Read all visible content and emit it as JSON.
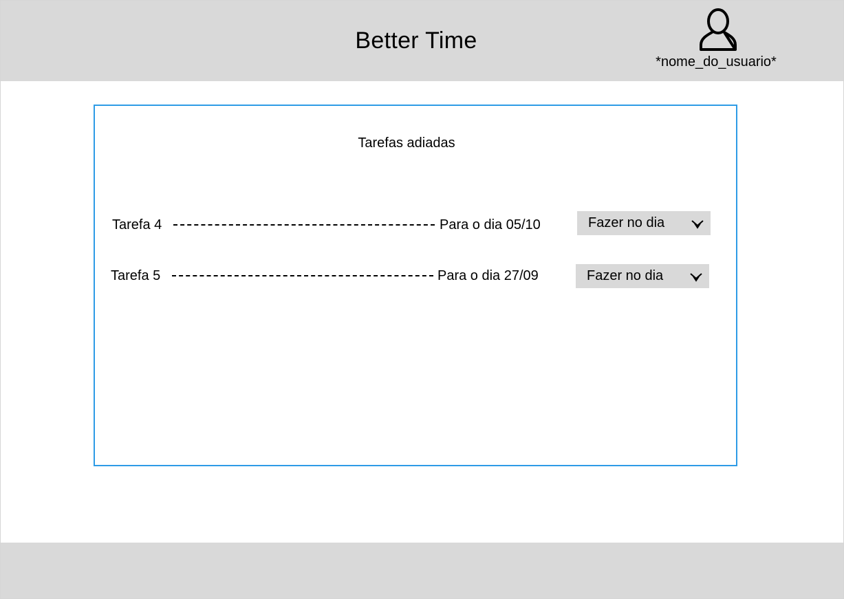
{
  "header": {
    "app_title": "Better Time",
    "user": {
      "name": "*nome_do_usuario*",
      "icon": "user-icon"
    }
  },
  "panel": {
    "title": "Tarefas adiadas",
    "border_color": "#2d9be6",
    "tasks": [
      {
        "name": "Tarefa 4",
        "date_label": "Para o dia 05/10",
        "action": {
          "selected": "Fazer no dia",
          "icon": "chevron-down-icon"
        }
      },
      {
        "name": "Tarefa 5",
        "date_label": "Para o dia 27/09",
        "action": {
          "selected": "Fazer no dia",
          "icon": "chevron-down-icon"
        }
      }
    ]
  },
  "colors": {
    "bar_background": "#d9d9d9",
    "page_background": "#ffffff",
    "panel_border": "#2d9be6",
    "text": "#000000"
  }
}
